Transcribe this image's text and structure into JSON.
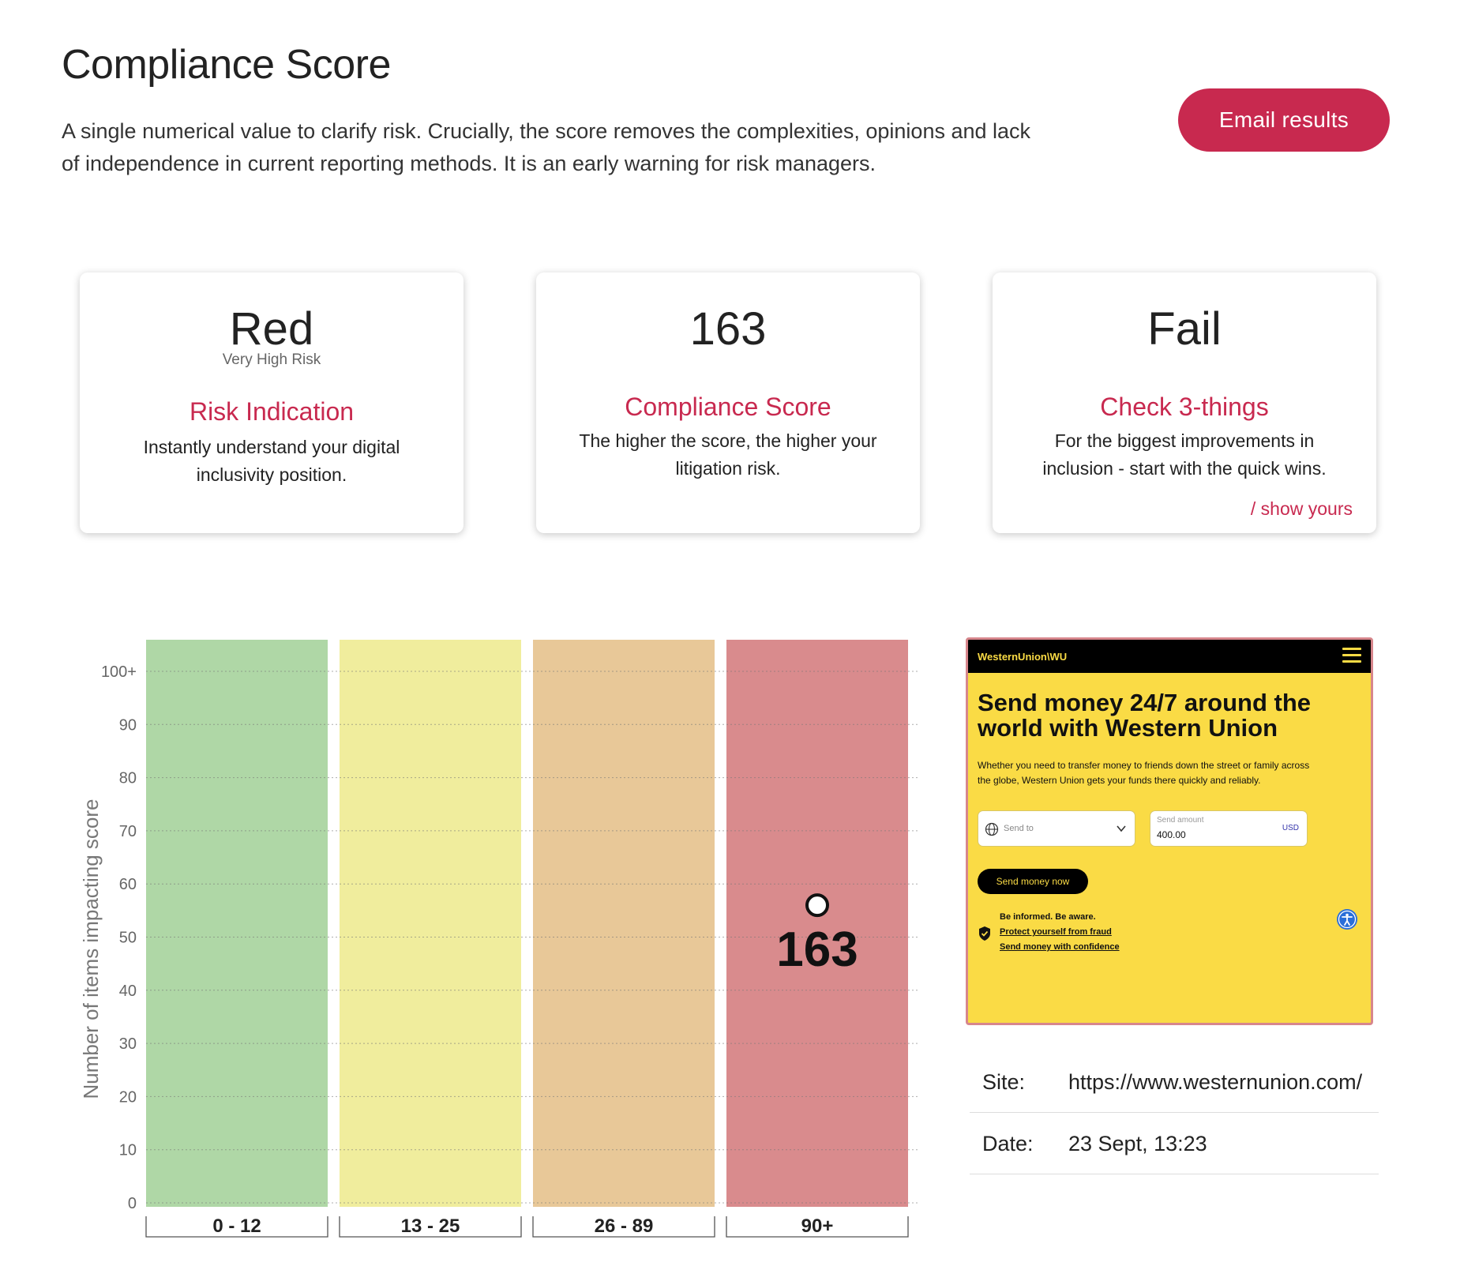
{
  "header": {
    "title": "Compliance Score",
    "description": "A single numerical value to clarify risk. Crucially, the score removes the complexities, opinions and lack of independence in current reporting methods. It is an early warning for risk managers.",
    "email_button": "Email results"
  },
  "cards": {
    "risk": {
      "value": "Red",
      "subvalue": "Very High Risk",
      "heading": "Risk Indication",
      "body": "Instantly understand your digital inclusivity position."
    },
    "score": {
      "value": "163",
      "heading": "Compliance Score",
      "body": "The higher the score, the higher your litigation risk."
    },
    "check": {
      "value": "Fail",
      "heading": "Check 3-things",
      "body": "For the biggest improvements in inclusion - start with the quick wins.",
      "link": "/ show yours"
    }
  },
  "colors": {
    "accent": "#c8294f",
    "band_green": "#afd7a6",
    "band_yellow": "#f0ed9d",
    "band_orange": "#e8c898",
    "band_red": "#d98b8d",
    "wu_yellow": "#fadb45"
  },
  "chart_data": {
    "type": "scatter",
    "ylabel": "Number of items impacting score",
    "yticks": [
      "0",
      "10",
      "20",
      "30",
      "40",
      "50",
      "60",
      "70",
      "80",
      "90",
      "100+"
    ],
    "ylim": [
      0,
      100
    ],
    "bands": [
      {
        "label": "0 - 12",
        "color": "#afd7a6"
      },
      {
        "label": "13 - 25",
        "color": "#f0ed9d"
      },
      {
        "label": "26 - 89",
        "color": "#e8c898"
      },
      {
        "label": "90+",
        "color": "#d98b8d"
      }
    ],
    "point": {
      "band": "90+",
      "y": 56,
      "label": "163"
    },
    "grid": true
  },
  "screenshot": {
    "logo": "WesternUnion\\WU",
    "headline": "Send money 24/7 around the world with Western Union",
    "paragraph": "Whether you need to transfer money to friends down the street or family across the globe, Western Union gets your funds there quickly and reliably.",
    "send_to_placeholder": "Send to",
    "amount_label": "Send amount",
    "amount_value": "400.00",
    "currency": "USD",
    "cta": "Send money now",
    "info_title": "Be informed. Be aware.",
    "link1": "Protect yourself from fraud",
    "link2": "Send money with confidence",
    "icons": [
      "menu-icon",
      "globe-icon",
      "chevron-down-icon",
      "shield-icon",
      "accessibility-icon"
    ]
  },
  "meta": {
    "site_label": "Site:",
    "site_value": "https://www.westernunion.com/",
    "date_label": "Date:",
    "date_value": "23 Sept, 13:23"
  }
}
